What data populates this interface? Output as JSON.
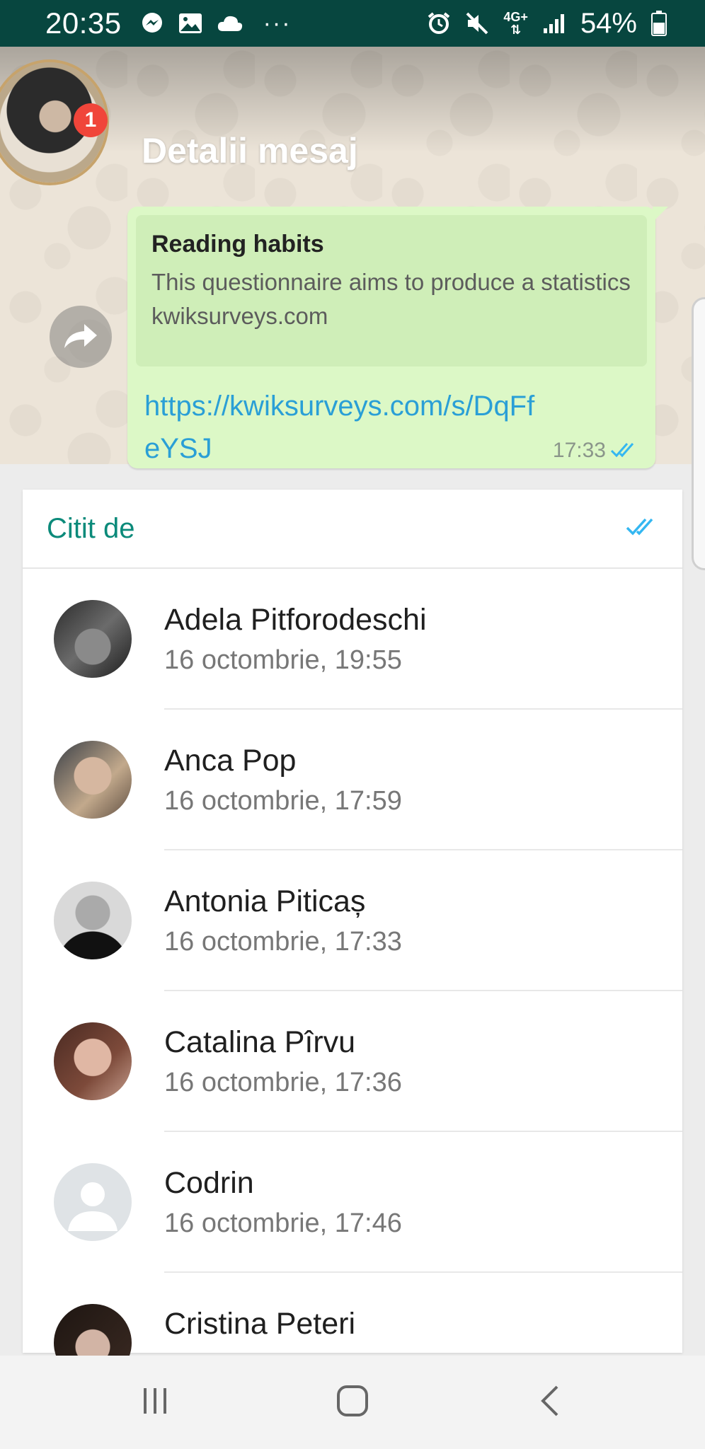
{
  "status_bar": {
    "time": "20:35",
    "network": "4G+",
    "battery": "54%",
    "left_icons": [
      "messenger-icon",
      "gallery-icon",
      "cloud-icon"
    ],
    "right_icons": [
      "alarm-icon",
      "mute-icon",
      "signal-icon",
      "battery-icon"
    ]
  },
  "header": {
    "title": "Detalii mesaj",
    "badge_count": "1"
  },
  "message": {
    "preview_title": "Reading habits",
    "preview_description": "This questionnaire aims to produce a statistics regarding the reading habits …",
    "preview_domain": "kwiksurveys.com",
    "link": "https://kwiksurveys.com/s/DqFfeYSJ",
    "time": "17:33",
    "status": "read"
  },
  "read_by": {
    "title": "Citit de",
    "entries": [
      {
        "name": "Adela Pitforodeschi",
        "time": "16 octombrie, 19:55"
      },
      {
        "name": "Anca Pop",
        "time": "16 octombrie, 17:59"
      },
      {
        "name": "Antonia Piticaș",
        "time": "16 octombrie, 17:33"
      },
      {
        "name": "Catalina Pîrvu",
        "time": "16 octombrie, 17:36"
      },
      {
        "name": "Codrin",
        "time": "16 octombrie, 17:46"
      },
      {
        "name": "Cristina Peteri",
        "time": ""
      }
    ]
  },
  "colors": {
    "status_bar": "#07463f",
    "accent": "#0b8a7a",
    "bubble": "#dcf8c6",
    "read_ticks": "#34b7f1",
    "badge": "#f0453a"
  },
  "nav": [
    "recent-apps-icon",
    "home-icon",
    "back-icon"
  ]
}
